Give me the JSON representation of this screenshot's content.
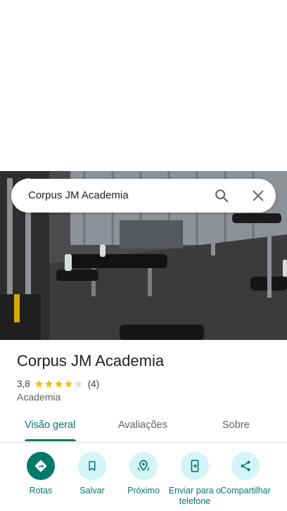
{
  "search": {
    "query": "Corpus JM Academia"
  },
  "place": {
    "name": "Corpus JM Academia",
    "rating": "3,8",
    "rating_value": 3.8,
    "reviews_count": "(4)",
    "category": "Academia"
  },
  "tabs": [
    {
      "label": "Visão geral",
      "active": true
    },
    {
      "label": "Avaliações",
      "active": false
    },
    {
      "label": "Sobre",
      "active": false
    }
  ],
  "actions": [
    {
      "label": "Rotas",
      "icon": "directions-icon"
    },
    {
      "label": "Salvar",
      "icon": "bookmark-icon"
    },
    {
      "label": "Próximo",
      "icon": "nearby-icon"
    },
    {
      "label": "Enviar para o telefone",
      "icon": "send-to-phone-icon"
    },
    {
      "label": "Compartilhar",
      "icon": "share-icon"
    }
  ],
  "colors": {
    "accent": "#00796b",
    "action_bg": "#d3f4f8",
    "star": "#fbbc04",
    "star_empty": "#dadce0"
  }
}
